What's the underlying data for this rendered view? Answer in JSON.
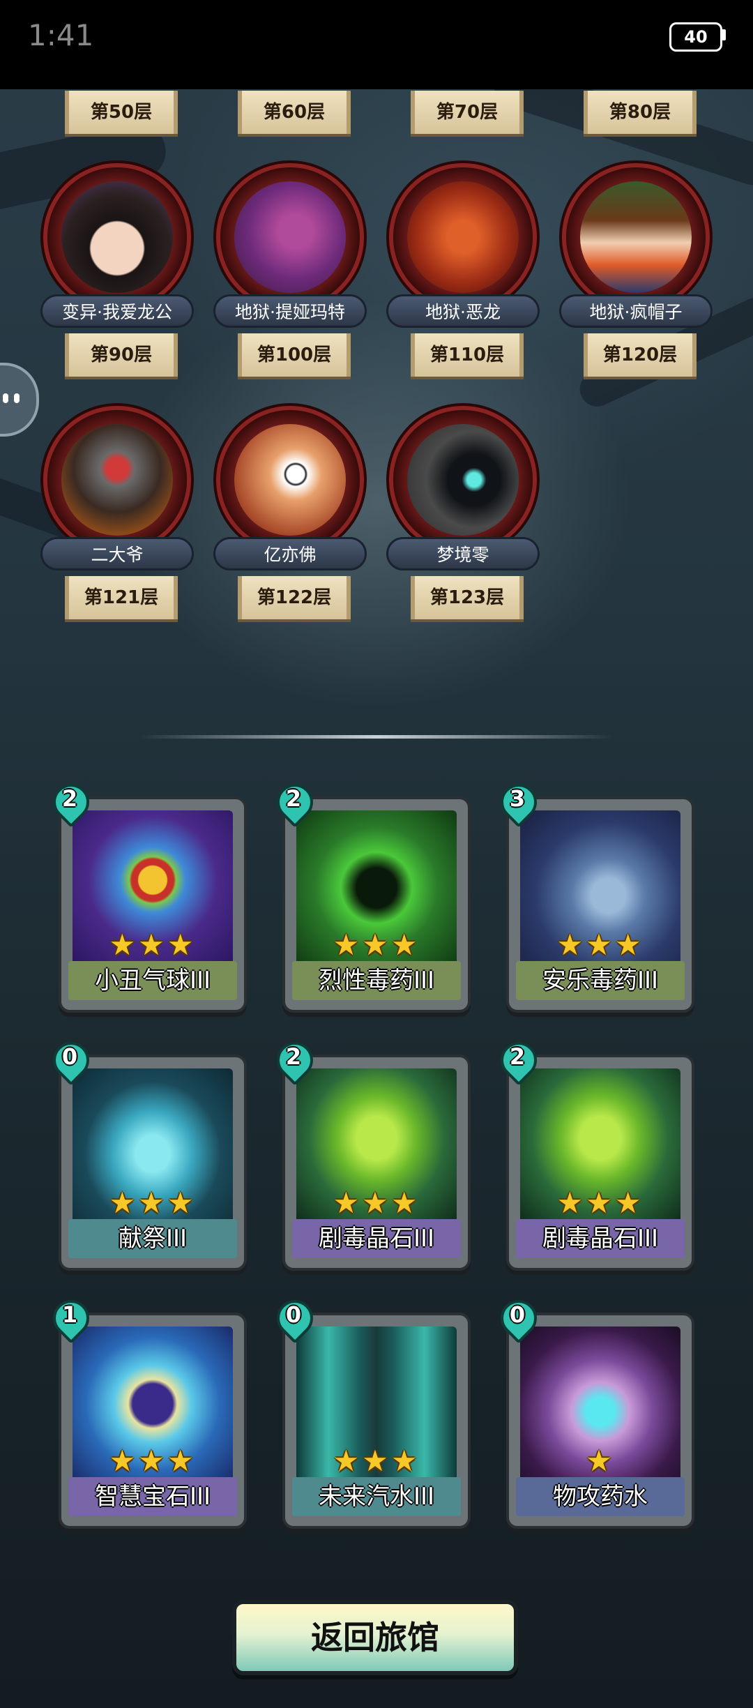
{
  "status_bar": {
    "time": "1:41",
    "battery": "40"
  },
  "top_floor_labels": [
    "第50层",
    "第60层",
    "第70层",
    "第80层"
  ],
  "bosses_row1": [
    {
      "name": "变异·我爱龙公",
      "floor": "第90层"
    },
    {
      "name": "地狱·提娅玛特",
      "floor": "第100层"
    },
    {
      "name": "地狱·恶龙",
      "floor": "第110层"
    },
    {
      "name": "地狱·疯帽子",
      "floor": "第120层"
    }
  ],
  "bosses_row2": [
    {
      "name": "二大爷",
      "floor": "第121层"
    },
    {
      "name": "亿亦佛",
      "floor": "第122层"
    },
    {
      "name": "梦境零",
      "floor": "第123层"
    }
  ],
  "cards": [
    {
      "name": "小丑气球III",
      "cost": "2",
      "stars": "★★★",
      "label_color": "#7a8f58"
    },
    {
      "name": "烈性毒药III",
      "cost": "2",
      "stars": "★★★",
      "label_color": "#7a8f58"
    },
    {
      "name": "安乐毒药III",
      "cost": "3",
      "stars": "★★★",
      "label_color": "#7a8f58"
    },
    {
      "name": "献祭III",
      "cost": "0",
      "stars": "★★★",
      "label_color": "#4f8a8f"
    },
    {
      "name": "剧毒晶石III",
      "cost": "2",
      "stars": "★★★",
      "label_color": "#7866a8"
    },
    {
      "name": "剧毒晶石III",
      "cost": "2",
      "stars": "★★★",
      "label_color": "#7866a8"
    },
    {
      "name": "智慧宝石III",
      "cost": "1",
      "stars": "★★★",
      "label_color": "#7866a8"
    },
    {
      "name": "未来汽水III",
      "cost": "0",
      "stars": "★★★",
      "label_color": "#4f8a8f"
    },
    {
      "name": "物攻药水",
      "cost": "0",
      "stars": "★",
      "label_color": "#5a6a98"
    }
  ],
  "return_button": "返回旅馆"
}
